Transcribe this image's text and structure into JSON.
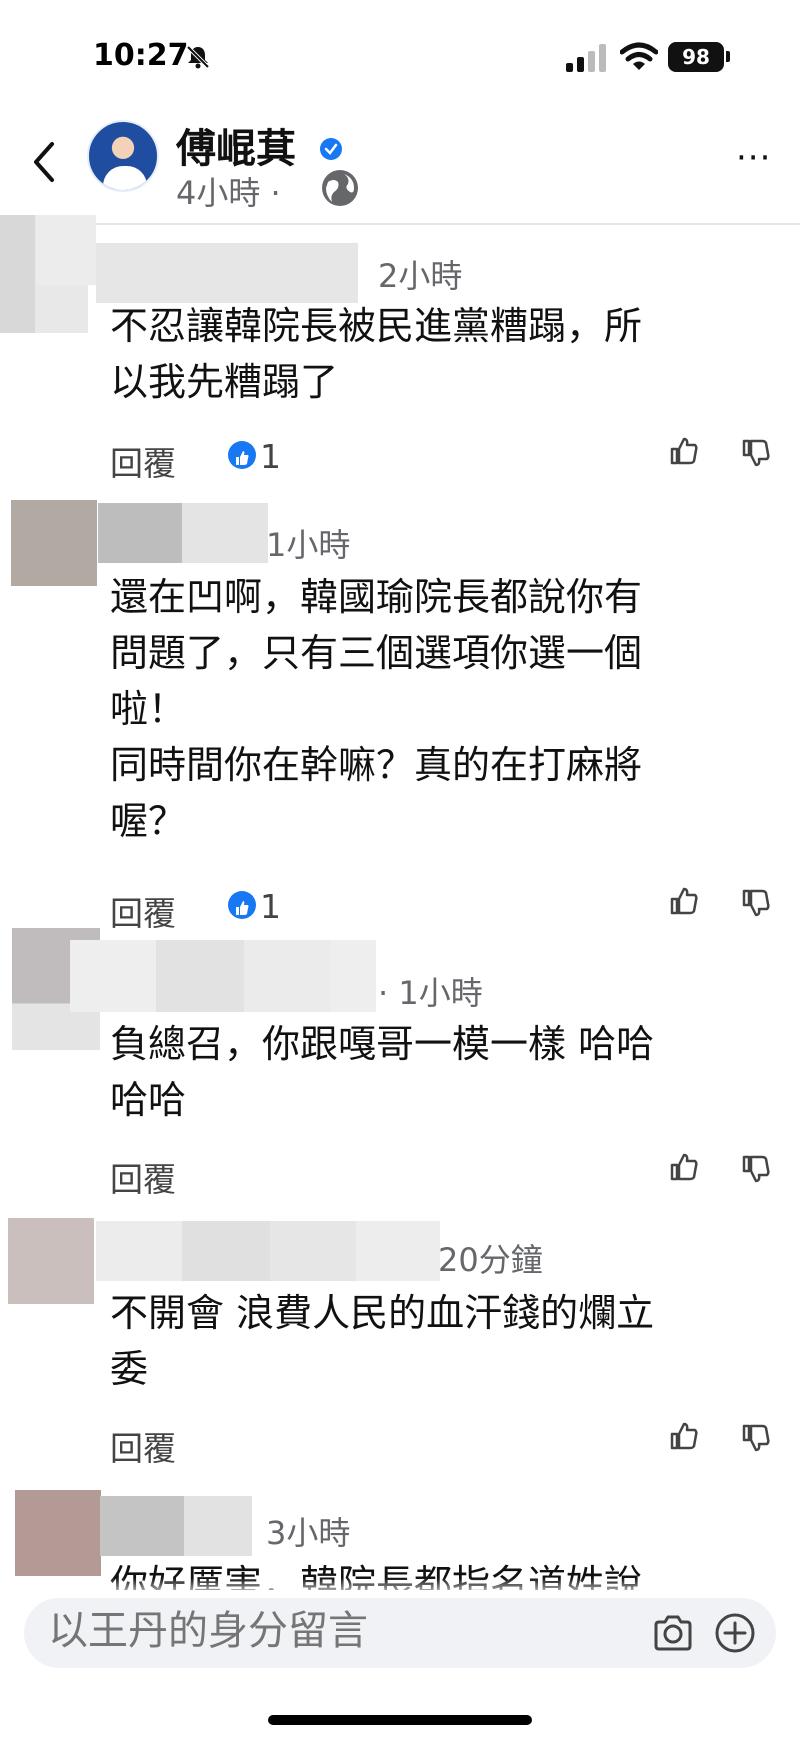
{
  "status_bar": {
    "time": "10:27",
    "battery": "98",
    "icons": [
      "bell-slash-icon",
      "cellular-signal-icon",
      "wifi-icon",
      "battery-icon"
    ]
  },
  "header": {
    "page_name": "傅崐萁",
    "post_time": "4小時 ·",
    "icons": [
      "back-chevron-icon",
      "verified-badge-icon",
      "globe-icon",
      "more-dots-icon"
    ],
    "more_label": "···"
  },
  "comments": [
    {
      "time": "2小時",
      "text": "不忍讓韓院長被民進黨糟蹋，所\n以我先糟蹋了",
      "reply_label": "回覆",
      "like_count": "1"
    },
    {
      "time": "1小時",
      "text": "還在凹啊，韓國瑜院長都說你有\n問題了，只有三個選項你選一個\n啦！\n同時間你在幹嘛？真的在打麻將\n喔？",
      "reply_label": "回覆",
      "like_count": "1"
    },
    {
      "time": "· 1小時",
      "text": "負總召，你跟嘎哥一模一樣 哈哈\n哈哈",
      "reply_label": "回覆",
      "like_count": ""
    },
    {
      "time": "20分鐘",
      "text": "不開會 浪費人民的血汗錢的爛立\n委",
      "reply_label": "回覆",
      "like_count": ""
    },
    {
      "time": "3小時",
      "text": "你好厲害，韓院長都指名道姓說",
      "reply_label": "",
      "like_count": ""
    }
  ],
  "composer": {
    "placeholder": "以王丹的身分留言",
    "icons": [
      "camera-icon",
      "plus-circle-icon"
    ]
  },
  "colors": {
    "accent": "#1877f2",
    "secondary_text": "#65676b",
    "composer_bg": "#f0f2f5"
  }
}
